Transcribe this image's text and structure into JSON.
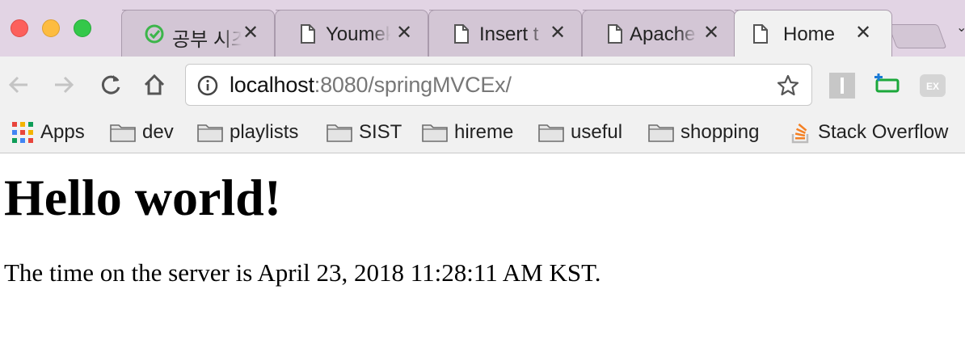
{
  "window": {
    "tabs": [
      {
        "label": "공부 시즈",
        "favicon": "study-timer-icon",
        "active": false
      },
      {
        "label": "Youmek",
        "favicon": "page-icon",
        "active": false
      },
      {
        "label": "Insert t",
        "favicon": "page-icon",
        "active": false
      },
      {
        "label": "Apache",
        "favicon": "page-icon",
        "active": false
      },
      {
        "label": "Home",
        "favicon": "page-icon",
        "active": true
      }
    ],
    "close_glyph": "✕"
  },
  "toolbar": {
    "url_host": "localhost",
    "url_rest": ":8080/springMVCEx/",
    "extensions": [
      "instapaper-icon",
      "tag-extension-icon",
      "ex-extension-icon"
    ]
  },
  "bookmarks": [
    {
      "label": "Apps",
      "icon": "apps-grid-icon"
    },
    {
      "label": "dev",
      "icon": "folder-icon"
    },
    {
      "label": "playlists",
      "icon": "folder-icon"
    },
    {
      "label": "SIST",
      "icon": "folder-icon"
    },
    {
      "label": "hireme",
      "icon": "folder-icon"
    },
    {
      "label": "useful",
      "icon": "folder-icon"
    },
    {
      "label": "shopping",
      "icon": "folder-icon"
    },
    {
      "label": "Stack Overflow",
      "icon": "stack-overflow-icon"
    }
  ],
  "page": {
    "heading": "Hello world!",
    "time_text": "The time on the server is April 23, 2018 11:28:11 AM KST."
  },
  "colors": {
    "tabstrip_bg": "#e2d4e4",
    "toolbar_bg": "#f1f1f1",
    "close_red": "#fc605c",
    "minimize_yellow": "#fdbc40",
    "zoom_green": "#34c84a"
  }
}
